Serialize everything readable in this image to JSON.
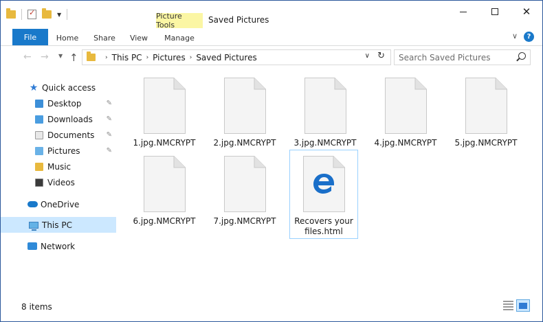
{
  "window": {
    "title": "Saved Pictures",
    "context_tab": "Picture Tools"
  },
  "ribbon": {
    "tabs": [
      "File",
      "Home",
      "Share",
      "View",
      "Manage"
    ]
  },
  "address": {
    "crumbs": [
      "This PC",
      "Pictures",
      "Saved Pictures"
    ]
  },
  "search": {
    "placeholder": "Search Saved Pictures"
  },
  "nav": {
    "quick_access": "Quick access",
    "items": [
      {
        "label": "Desktop",
        "pinned": true
      },
      {
        "label": "Downloads",
        "pinned": true
      },
      {
        "label": "Documents",
        "pinned": true
      },
      {
        "label": "Pictures",
        "pinned": true
      },
      {
        "label": "Music",
        "pinned": false
      },
      {
        "label": "Videos",
        "pinned": false
      }
    ],
    "onedrive": "OneDrive",
    "this_pc": "This PC",
    "network": "Network"
  },
  "files": [
    {
      "name": "1.jpg.NMCRYPT",
      "type": "generic"
    },
    {
      "name": "2.jpg.NMCRYPT",
      "type": "generic"
    },
    {
      "name": "3.jpg.NMCRYPT",
      "type": "generic"
    },
    {
      "name": "4.jpg.NMCRYPT",
      "type": "generic"
    },
    {
      "name": "5.jpg.NMCRYPT",
      "type": "generic"
    },
    {
      "name": "6.jpg.NMCRYPT",
      "type": "generic"
    },
    {
      "name": "7.jpg.NMCRYPT",
      "type": "generic"
    },
    {
      "name": "Recovers your files.html",
      "type": "edge-html",
      "selected": true
    }
  ],
  "status": {
    "count": "8 items"
  },
  "colors": {
    "accent": "#1979ca",
    "context_tab": "#fbf6a4",
    "selection": "#cce8ff"
  }
}
